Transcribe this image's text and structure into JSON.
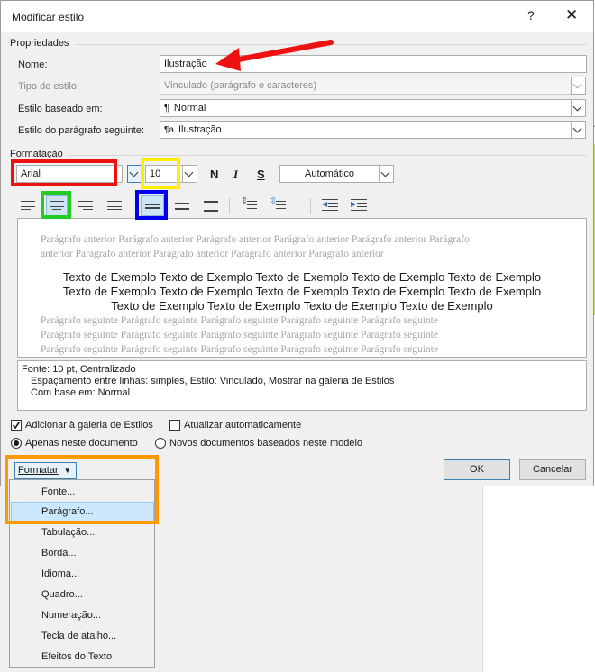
{
  "dialog": {
    "title": "Modificar estilo",
    "help_icon": "?",
    "close_icon": "✕"
  },
  "properties": {
    "group_label": "Propriedades",
    "name_label": "Nome:",
    "name_value": "Ilustração",
    "type_label": "Tipo de estilo:",
    "type_value": "Vinculado (parágrafo e caracteres)",
    "based_label": "Estilo baseado em:",
    "based_value": "Normal",
    "next_label": "Estilo do parágrafo seguinte:",
    "next_value": "Ilustração"
  },
  "formatting": {
    "group_label": "Formatação",
    "font": "Arial",
    "size": "10",
    "bold": "N",
    "italic": "I",
    "underline": "S",
    "color": "Automático"
  },
  "preview": {
    "previous_lines": [
      "Parágrafo anterior Parágrafo anterior Parágrafo anterior Parágrafo anterior Parágrafo anterior Parágrafo",
      "anterior Parágrafo anterior Parágrafo anterior Parágrafo anterior Parágrafo anterior"
    ],
    "sample_lines": [
      "Texto de Exemplo Texto de Exemplo Texto de Exemplo Texto de Exemplo Texto de Exemplo",
      "Texto de Exemplo Texto de Exemplo Texto de Exemplo Texto de Exemplo Texto de Exemplo",
      "Texto de Exemplo Texto de Exemplo Texto de Exemplo Texto de Exemplo"
    ],
    "next_lines": [
      "Parágrafo seguinte Parágrafo seguinte Parágrafo seguinte Parágrafo seguinte Parágrafo seguinte",
      "Parágrafo seguinte Parágrafo seguinte Parágrafo seguinte Parágrafo seguinte Parágrafo seguinte",
      "Parágrafo seguinte Parágrafo seguinte Parágrafo seguinte Parágrafo seguinte Parágrafo seguinte"
    ]
  },
  "description": {
    "line1": "Fonte: 10 pt, Centralizado",
    "line2": "Espaçamento entre linhas:  simples, Estilo: Vinculado, Mostrar na galeria de Estilos",
    "line3": "Com base em: Normal"
  },
  "options": {
    "add_gallery": "Adicionar à galeria de Estilos",
    "add_gallery_checked": true,
    "auto_update": "Atualizar automaticamente",
    "auto_update_checked": false,
    "only_this_doc": "Apenas neste documento",
    "new_docs": "Novos documentos baseados neste modelo",
    "selected_scope": "only_this_doc"
  },
  "buttons": {
    "format": "Formatar",
    "ok": "OK",
    "cancel": "Cancelar"
  },
  "format_menu": [
    "Fonte...",
    "Parágrafo...",
    "Tabulação...",
    "Borda...",
    "Idioma...",
    "Quadro...",
    "Numeração...",
    "Tecla de atalho...",
    "Efeitos do Texto"
  ],
  "format_menu_selected_index": 1,
  "annotation_colors": {
    "arrow": "#ee1111",
    "font_box": "#ee1111",
    "size_box": "#ffee00",
    "center_align_box": "#22cc22",
    "single_spacing_box": "#0000ee",
    "format_menu_box": "#ff9900"
  }
}
